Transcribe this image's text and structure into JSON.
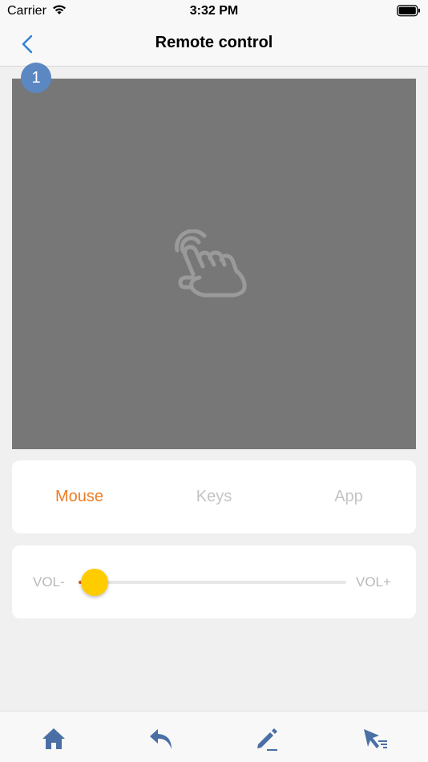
{
  "status": {
    "carrier": "Carrier",
    "time": "3:32 PM"
  },
  "nav": {
    "title": "Remote control",
    "back_icon": "chevron-left-icon"
  },
  "badge": {
    "number": "1"
  },
  "modes": {
    "mouse": "Mouse",
    "keys": "Keys",
    "app": "App",
    "selected": "Mouse"
  },
  "volume": {
    "minus_label": "VOL-",
    "plus_label": "VOL+",
    "level": 0.02
  },
  "colors": {
    "accent": "#ef7d22",
    "badge": "#5b87c3",
    "thumb": "#ffcc00",
    "touchpad": "#777777",
    "tab_icon": "#4a6fa5"
  },
  "tabbar": {
    "items": [
      {
        "icon": "home-icon"
      },
      {
        "icon": "back-arrow-icon"
      },
      {
        "icon": "pen-icon"
      },
      {
        "icon": "cursor-icon"
      }
    ]
  }
}
